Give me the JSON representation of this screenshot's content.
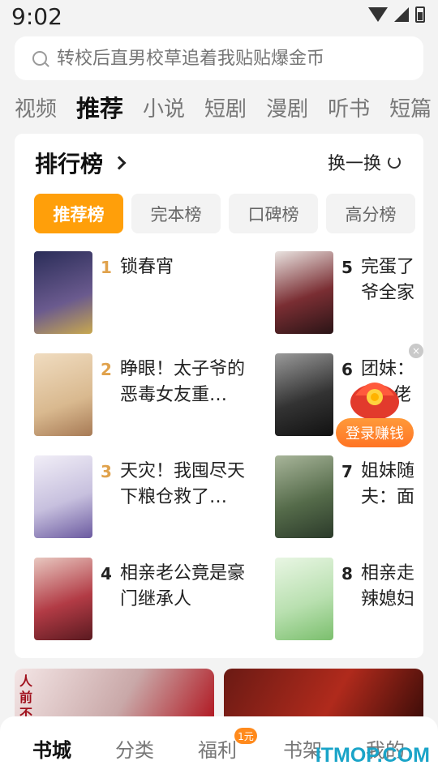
{
  "status": {
    "time": "9:02"
  },
  "search": {
    "placeholder": "转校后直男校草追着我贴贴爆金币"
  },
  "tabs": [
    "视频",
    "推荐",
    "小说",
    "短剧",
    "漫剧",
    "听书",
    "短篇"
  ],
  "ranking": {
    "title": "排行榜",
    "refresh_label": "换一换",
    "subtabs": [
      "推荐榜",
      "完本榜",
      "口碑榜",
      "高分榜"
    ],
    "books": [
      {
        "rank": "1",
        "title": "锁春宵",
        "cover_color": "#3b3f6e"
      },
      {
        "rank": "2",
        "title": "睁眼！太子爷的恶毒女友重…",
        "cover_color": "#e7d3b8"
      },
      {
        "rank": "3",
        "title": "天灾！我囤尽天下粮仓救了…",
        "cover_color": "#d9d6e8"
      },
      {
        "rank": "4",
        "title": "相亲老公竟是豪门继承人",
        "cover_color": "#b23b45"
      },
      {
        "rank": "5",
        "title": "完蛋了爷全家",
        "cover_color": "#5a2a2e"
      },
      {
        "rank": "6",
        "title": "团妹：…佬",
        "cover_color": "#333333"
      },
      {
        "rank": "7",
        "title": "姐妹随夫：面",
        "cover_color": "#556b4a"
      },
      {
        "rank": "8",
        "title": "相亲走辣媳妇",
        "cover_color": "#c9e9c1"
      }
    ],
    "book6_top": "团妹：",
    "book6_bottom": "佬"
  },
  "reward": {
    "label": "登录赚钱",
    "close": "×"
  },
  "banner_text": "人前不",
  "bottom_nav": [
    "书城",
    "分类",
    "福利",
    "书架",
    "我的"
  ],
  "badge": "1元",
  "watermark": "ITMOP.COM",
  "colors": {
    "accent": "#ff9f0a",
    "rank_gold": "#e0a24c",
    "reward": "#ff7a26"
  }
}
